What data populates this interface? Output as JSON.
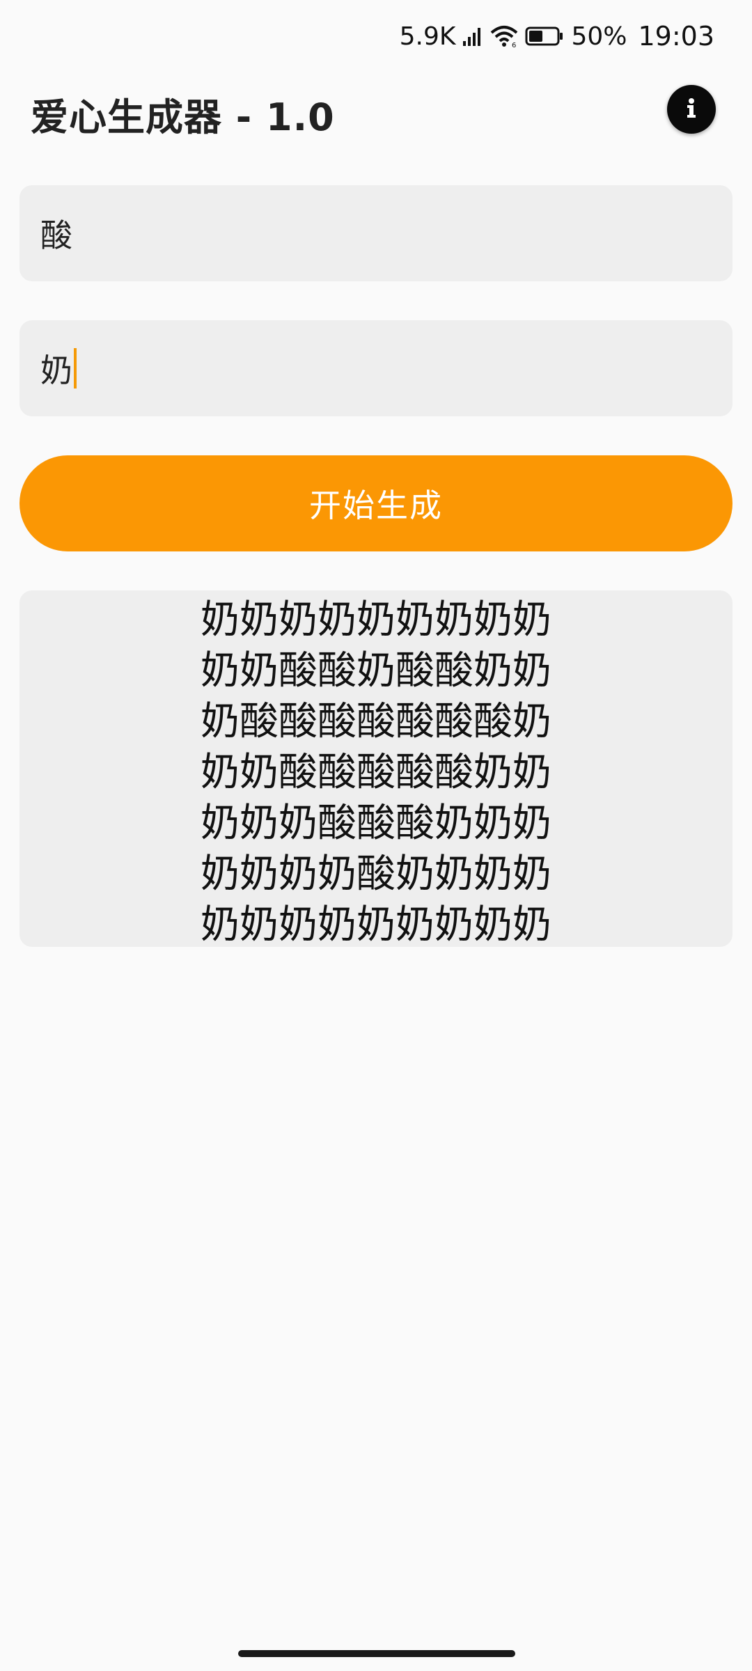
{
  "status_bar": {
    "net_speed": "5.9K",
    "battery_percent": "50%",
    "time": "19:03",
    "battery_level": 0.5
  },
  "app": {
    "title": "爱心生成器 - 1.0",
    "info_icon": "info-icon"
  },
  "inputs": {
    "fill_char": "酸",
    "background_char": "奶"
  },
  "button": {
    "generate_label": "开始生成"
  },
  "colors": {
    "accent": "#fb9704",
    "caret": "#f59a07",
    "field_bg": "#eeeeee",
    "page_bg": "#fafafa"
  },
  "result": {
    "lines": [
      "奶奶奶奶奶奶奶奶奶",
      "奶奶酸酸奶酸酸奶奶",
      "奶酸酸酸酸酸酸酸奶",
      "奶奶酸酸酸酸酸奶奶",
      "奶奶奶酸酸酸奶奶奶",
      "奶奶奶奶酸奶奶奶奶",
      "奶奶奶奶奶奶奶奶奶"
    ]
  }
}
